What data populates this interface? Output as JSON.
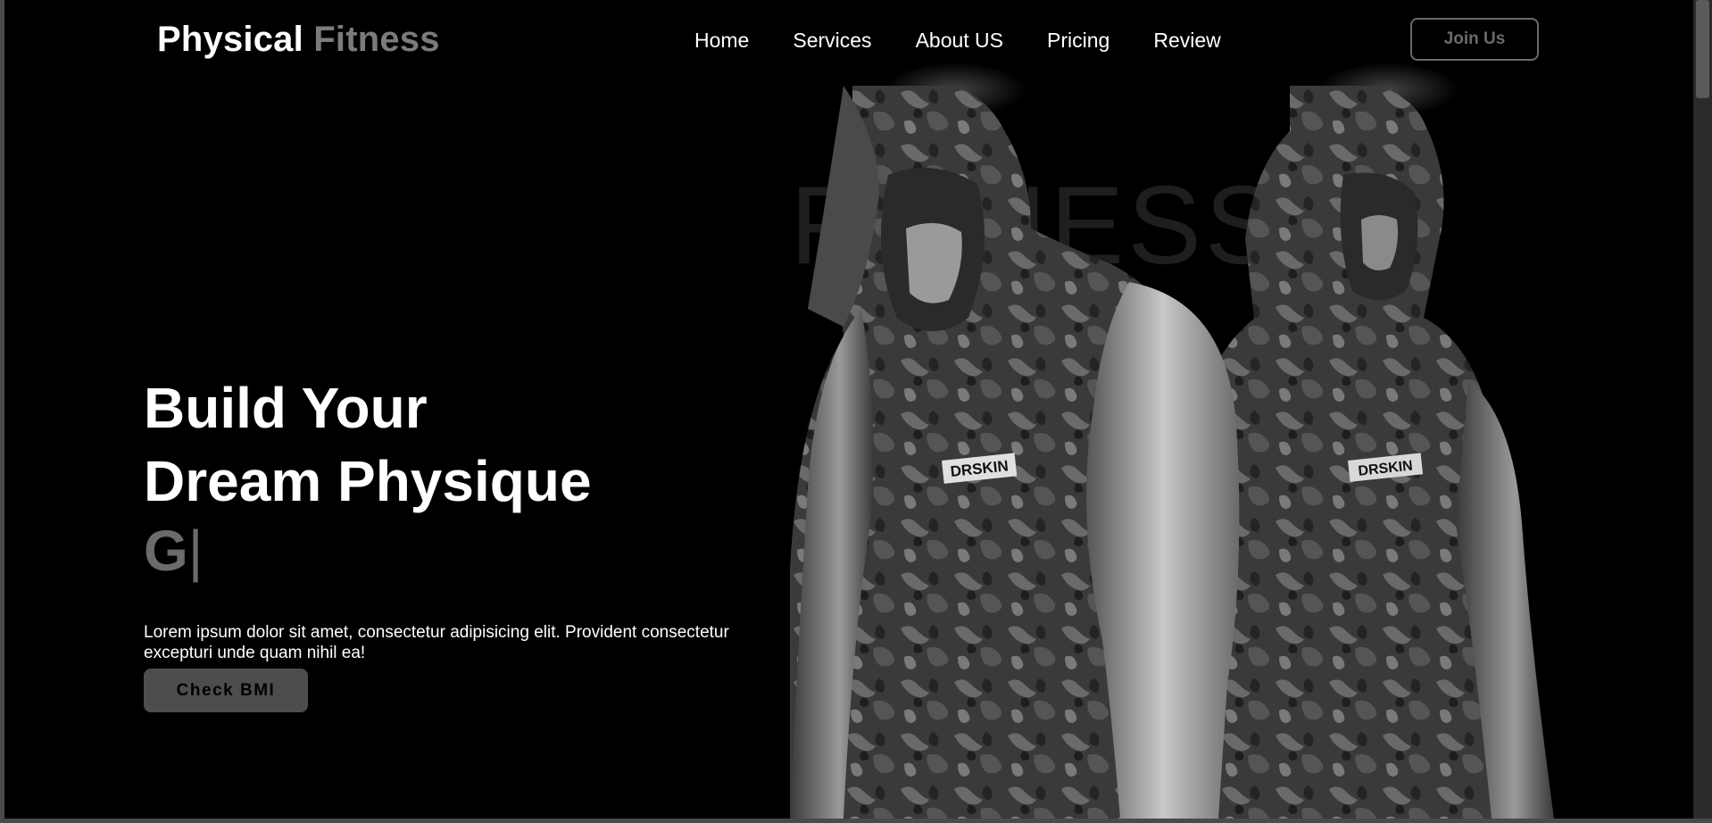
{
  "brand": {
    "primary": "Physical",
    "accent": "Fitness"
  },
  "nav": {
    "items": [
      {
        "label": "Home"
      },
      {
        "label": "Services"
      },
      {
        "label": "About US"
      },
      {
        "label": "Pricing"
      },
      {
        "label": "Review"
      }
    ],
    "cta_label": "Join Us"
  },
  "hero": {
    "headline_line1": "Build Your",
    "headline_line2": "Dream Physique",
    "typed_text": "G",
    "caret": "|",
    "description": "Lorem ipsum dolor sit amet, consectetur adipisicing elit. Provident consectetur excepturi unde quam nihil ea!",
    "button_label": "Check BMI",
    "background_word": "FITNESS",
    "shirt_logo_text": "DRSKIN"
  },
  "colors": {
    "background": "#000000",
    "accent_gray": "#7b7b7b",
    "button_gray": "#4d4d4d",
    "text": "#ffffff"
  }
}
